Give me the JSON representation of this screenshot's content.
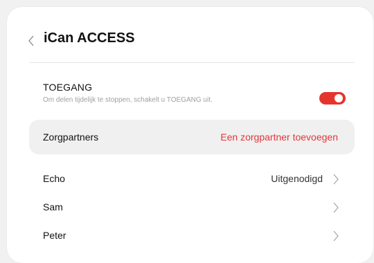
{
  "header": {
    "title": "iCan ACCESS",
    "back_icon": "chevron-left-icon"
  },
  "access_toggle": {
    "label": "TOEGANG",
    "description": "Om delen tijdelijk te stoppen, schakelt u TOEGANG uit.",
    "enabled": true,
    "color": "#e5342e"
  },
  "partners": {
    "label": "Zorgpartners",
    "add_label": "Een zorgpartner toevoegen",
    "add_color": "#e2353a"
  },
  "contacts": [
    {
      "name": "Echo",
      "status": "Uitgenodigd"
    },
    {
      "name": "Sam",
      "status": ""
    },
    {
      "name": "Peter",
      "status": ""
    }
  ]
}
